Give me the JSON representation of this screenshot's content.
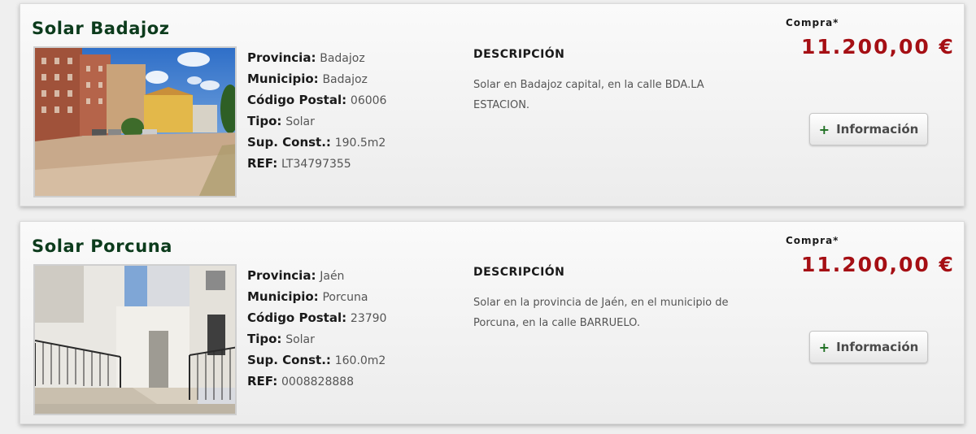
{
  "listings": [
    {
      "title": "Solar Badajoz",
      "image_alt": "Solar en Badajoz capital",
      "details": [
        {
          "label": "Provincia:",
          "value": "Badajoz"
        },
        {
          "label": "Municipio:",
          "value": "Badajoz"
        },
        {
          "label": "Código Postal:",
          "value": "06006"
        },
        {
          "label": "Tipo:",
          "value": "Solar"
        },
        {
          "label": "Sup. Const.:",
          "value": "190.5m2"
        },
        {
          "label": "REF:",
          "value": "LT34797355"
        }
      ],
      "description_heading": "DESCRIPCIÓN",
      "description": "Solar en Badajoz capital, en la calle BDA.LA ESTACION.",
      "buy_label": "Compra*",
      "price": "11.200,00 €",
      "info_button": "Información",
      "plus_icon": "+"
    },
    {
      "title": "Solar Porcuna",
      "image_alt": "Solar en Porcuna",
      "details": [
        {
          "label": "Provincia:",
          "value": "Jaén"
        },
        {
          "label": "Municipio:",
          "value": "Porcuna"
        },
        {
          "label": "Código Postal:",
          "value": "23790"
        },
        {
          "label": "Tipo:",
          "value": "Solar"
        },
        {
          "label": "Sup. Const.:",
          "value": "160.0m2"
        },
        {
          "label": "REF:",
          "value": "0008828888"
        }
      ],
      "description_heading": "DESCRIPCIÓN",
      "description": "Solar en la provincia de Jaén, en el municipio de Porcuna, en la calle BARRUELO.",
      "buy_label": "Compra*",
      "price": "11.200,00 €",
      "info_button": "Información",
      "plus_icon": "+"
    }
  ],
  "colors": {
    "title": "#0c3b1c",
    "price": "#a50f14",
    "plus": "#1c6e20"
  }
}
